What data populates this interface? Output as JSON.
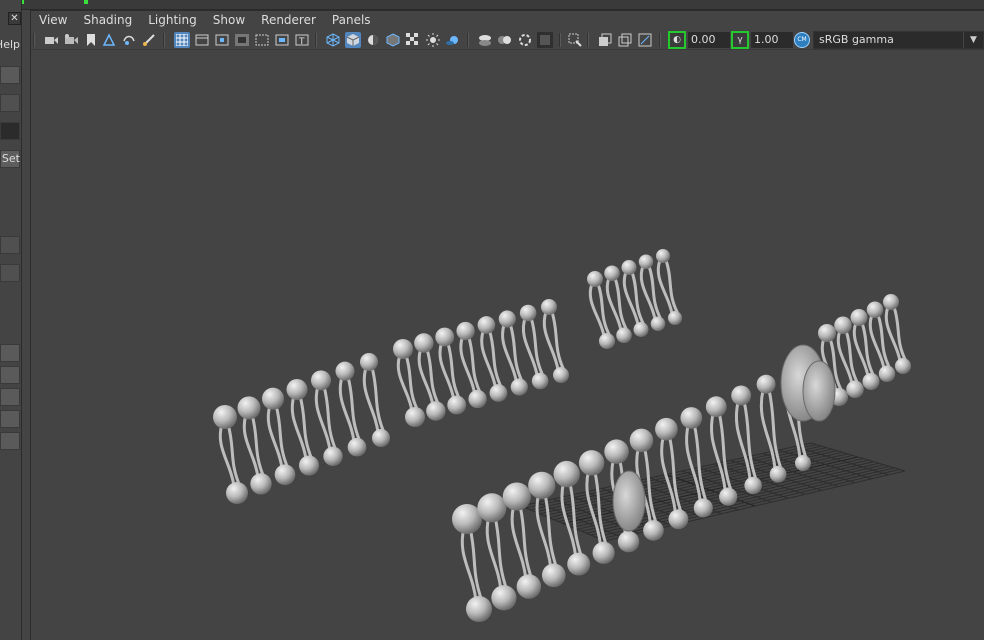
{
  "window": {
    "close_glyph": "✕"
  },
  "left_panel": {
    "help_label": "Help",
    "set_label": "Set"
  },
  "menubar": {
    "items": [
      "View",
      "Shading",
      "Lighting",
      "Show",
      "Renderer",
      "Panels"
    ]
  },
  "toolbar": {
    "exposure_value": "0.00",
    "gamma_value": "1.00",
    "color_space": "sRGB gamma",
    "icons": [
      "select-camera-icon",
      "camera-attributes-icon",
      "bookmark-icon",
      "image-plane-icon",
      "2d-pan-zoom-icon",
      "grease-pencil-icon",
      "grid-icon",
      "film-gate-icon",
      "resolution-gate-icon",
      "gate-mask-icon",
      "field-chart-icon",
      "safe-action-icon",
      "safe-title-icon",
      "wireframe-icon",
      "smooth-shade-icon",
      "default-material-icon",
      "wireframe-on-shaded-icon",
      "textured-icon",
      "use-all-lights-icon",
      "shadows-icon",
      "screen-space-ao-icon",
      "motion-blur-icon",
      "multisample-aa-icon",
      "depth-of-field-icon",
      "isolate-select-icon",
      "xray-icon",
      "xray-joints-icon",
      "backface-culling-icon",
      "exposure-icon",
      "gamma-icon",
      "color-management-icon"
    ],
    "accent_green": "#24c92e",
    "accent_blue": "#5286bc"
  },
  "scene": {
    "description_icon": "lipid-bilayer-3d-model",
    "background": "#444444"
  }
}
